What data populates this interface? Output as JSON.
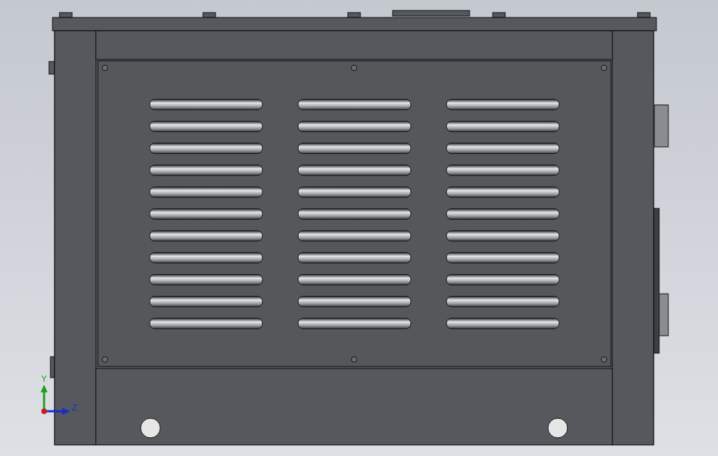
{
  "viewport": {
    "triad": {
      "axes": [
        {
          "label": "Y",
          "kind": "vertical"
        },
        {
          "label": "Z",
          "kind": "horizontal"
        }
      ]
    }
  }
}
